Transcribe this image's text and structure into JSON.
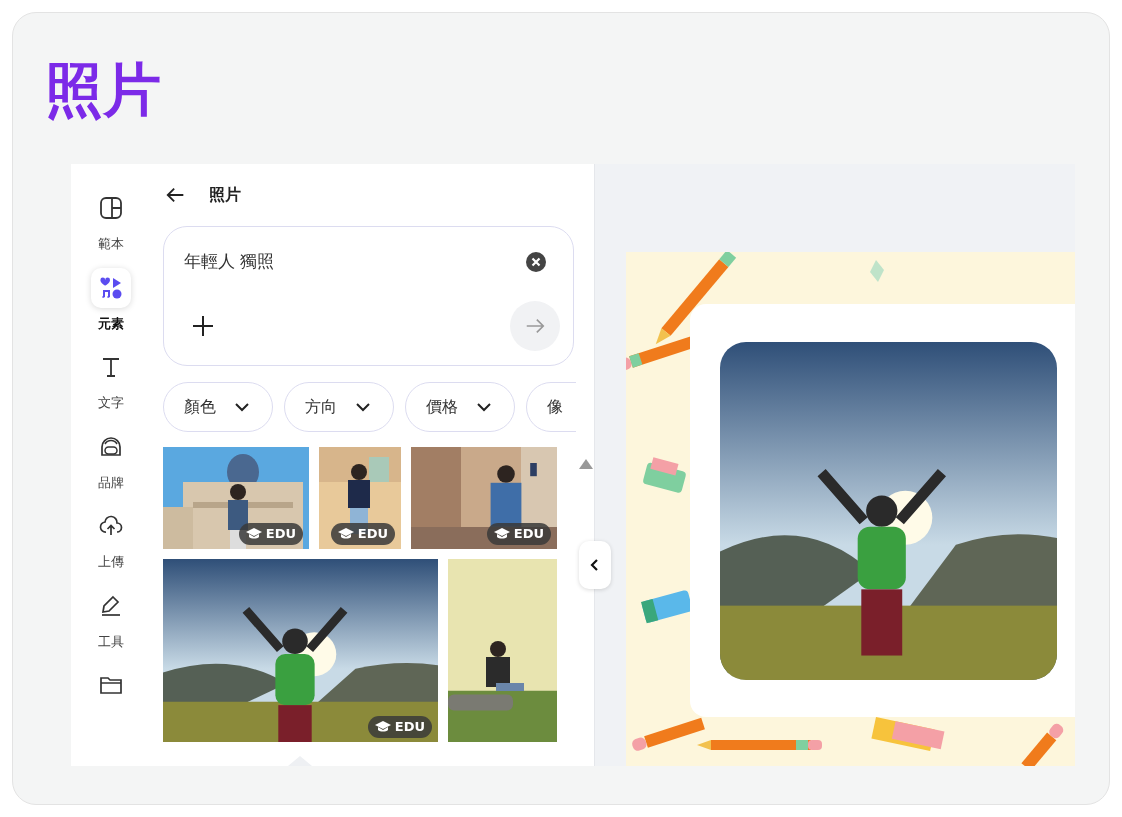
{
  "heading": "照片",
  "rail": [
    {
      "label": "範本",
      "selected": false
    },
    {
      "label": "元素",
      "selected": true
    },
    {
      "label": "文字",
      "selected": false
    },
    {
      "label": "品牌",
      "selected": false
    },
    {
      "label": "上傳",
      "selected": false
    },
    {
      "label": "工具",
      "selected": false
    },
    {
      "selected": false
    }
  ],
  "panel": {
    "title": "照片",
    "search": {
      "value": "年輕人 獨照"
    },
    "filters": [
      "顏色",
      "方向",
      "價格",
      "像"
    ],
    "photos": [
      {
        "kind": "picture",
        "badge": "EDU"
      },
      {
        "kind": "picture",
        "badge": "EDU"
      },
      {
        "kind": "picture",
        "badge": "EDU"
      },
      {
        "kind": "picture",
        "badge": "EDU"
      },
      {
        "kind": "picture"
      }
    ]
  },
  "canvas": {
    "photo": {
      "kind": "picture"
    }
  }
}
